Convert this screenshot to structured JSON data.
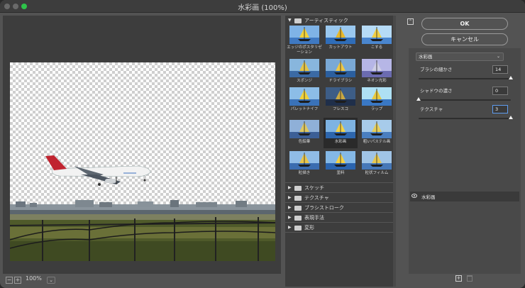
{
  "window": {
    "title": "水彩画 (100%)"
  },
  "preview": {
    "zoom_minus": "−",
    "zoom_plus": "+",
    "zoom_value": "100%",
    "zoom_dropdown": "⌄"
  },
  "gallery": {
    "open_folder": {
      "label": "アーティスティック",
      "arrow": "▼"
    },
    "filters": [
      {
        "label": "エッジのポスタリゼーション"
      },
      {
        "label": "カットアウト"
      },
      {
        "label": "こする"
      },
      {
        "label": "スポンジ"
      },
      {
        "label": "ドライブラシ"
      },
      {
        "label": "ネオン光彩"
      },
      {
        "label": "パレットナイフ"
      },
      {
        "label": "フレスコ"
      },
      {
        "label": "ラップ"
      },
      {
        "label": "色鉛筆"
      },
      {
        "label": "水彩画"
      },
      {
        "label": "粗いパステル画"
      },
      {
        "label": "粒描き"
      },
      {
        "label": "塗料"
      },
      {
        "label": "粒状フィルム"
      }
    ],
    "selected_filter": "水彩画",
    "closed_folders": [
      {
        "label": "スケッチ",
        "arrow": "▶"
      },
      {
        "label": "テクスチャ",
        "arrow": "▶"
      },
      {
        "label": "ブラシストローク",
        "arrow": "▶"
      },
      {
        "label": "表現手法",
        "arrow": "▶"
      },
      {
        "label": "変形",
        "arrow": "▶"
      }
    ]
  },
  "controls": {
    "collapse_icon": "⌃",
    "ok_label": "OK",
    "cancel_label": "キャンセル",
    "filter_select": "水彩画",
    "filter_select_chevron": "⌄",
    "params": [
      {
        "label": "ブラシの細かさ",
        "value": "14",
        "fraction": 1.0
      },
      {
        "label": "シャドウの濃さ",
        "value": "0",
        "fraction": 0.0
      },
      {
        "label": "テクスチャ",
        "value": "3",
        "fraction": 1.0
      }
    ]
  },
  "layers": {
    "items": [
      {
        "name": "水彩画",
        "visible": true
      }
    ],
    "new_layer_icon": "+"
  },
  "colors": {
    "accent": "#5e9cf0",
    "window_bg": "#535353",
    "panel_bg": "#3d3d3d"
  }
}
